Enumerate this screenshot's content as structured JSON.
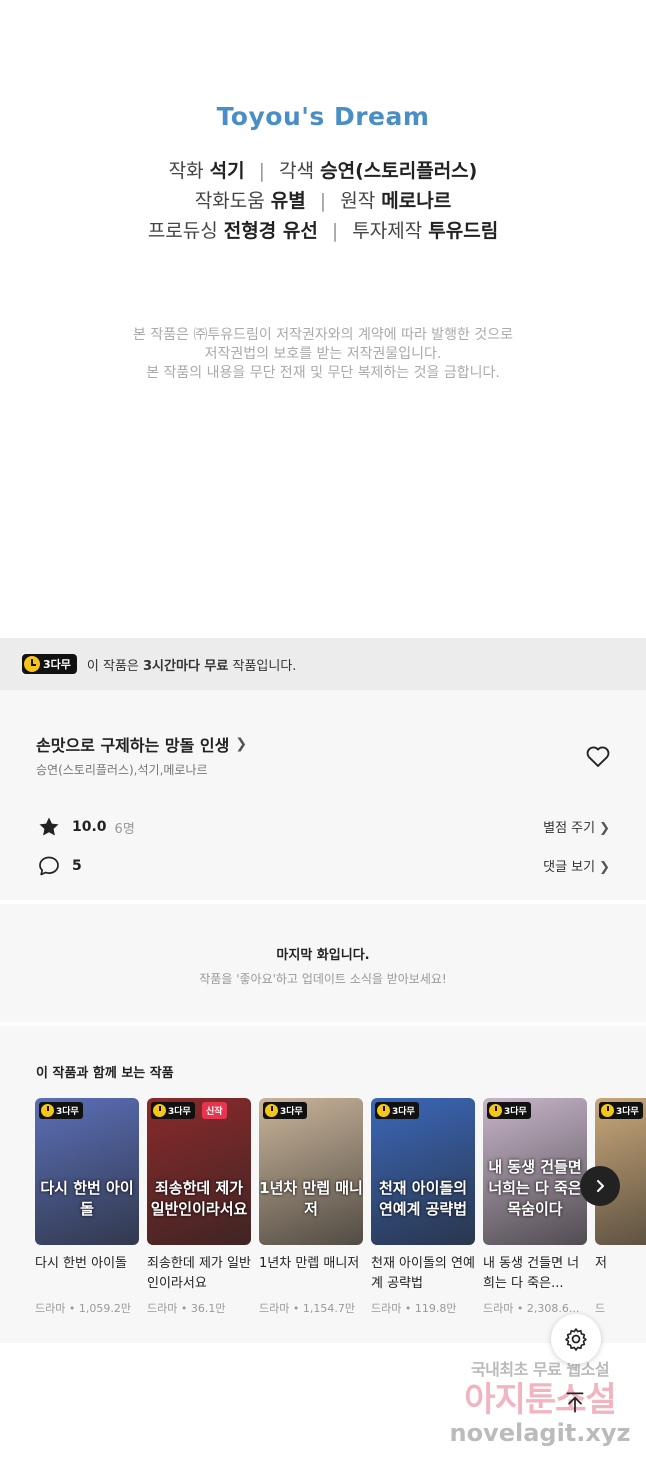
{
  "credits": {
    "logo": "Toyou's Dream",
    "line1": [
      {
        "label": "작화",
        "value": "석기"
      },
      {
        "label": "각색",
        "value": "승연(스토리플러스)"
      }
    ],
    "line2": [
      {
        "label": "작화도움",
        "value": "유별"
      },
      {
        "label": "원작",
        "value": "메로나르"
      }
    ],
    "line3": [
      {
        "label": "프로듀싱",
        "value": "전형경 유선"
      },
      {
        "label": "투자제작",
        "value": "투유드림"
      }
    ],
    "copyright": [
      "본 작품은 ㈜투유드림이 저작권자와의 계약에 따라 발행한 것으로",
      "저작권법의 보호를 받는 저작권물입니다.",
      "본 작품의 내용을 무단 전재 및 무단 복제하는 것을 금합니다."
    ]
  },
  "free_banner": {
    "badge": "3다무",
    "text_pre": "이 작품은 ",
    "text_bold": "3시간마다 무료",
    "text_post": " 작품입니다."
  },
  "work": {
    "title": "손맛으로 구제하는 망돌 인생",
    "authors": "승연(스토리플러스),석기,메로나르",
    "rating": "10.0",
    "rating_count": "6명",
    "rate_link": "별점 주기",
    "comments": "5",
    "comments_link": "댓글 보기"
  },
  "last_episode": {
    "title": "마지막 화입니다.",
    "subtitle": "작품을 '좋아요'하고 업데이트 소식을 받아보세요!"
  },
  "recommendations": {
    "heading": "이 작품과 함께 보는 작품",
    "badge": "3다무",
    "new_badge": "신작",
    "items": [
      {
        "title": "다시 한번 아이돌",
        "meta": "드라마 • 1,059.2만",
        "art": "다시 한번 아이돌",
        "color": "#5a6fb8",
        "is_new": false
      },
      {
        "title": "죄송한데 제가 일반인이라서요",
        "meta": "드라마 • 36.1만",
        "art": "죄송한데 제가 일반인이라서요",
        "color": "#8a2a2a",
        "is_new": true
      },
      {
        "title": "1년차 만렙 매니저",
        "meta": "드라마 • 1,154.7만",
        "art": "1년차 만렙 매니저",
        "color": "#c9b49a",
        "is_new": false
      },
      {
        "title": "천재 아이돌의 연예계 공략법",
        "meta": "드라마 • 119.8만",
        "art": "천재 아이돌의 연예계 공략법",
        "color": "#3b67b8",
        "is_new": false
      },
      {
        "title": "내 동생 건들면 너희는 다 죽은...",
        "meta": "드라마 • 2,308.6...",
        "art": "내 동생 건들면 너희는 다 죽은 목숨이다",
        "color": "#c7b5c9",
        "is_new": false
      },
      {
        "title": "저",
        "meta": "드",
        "art": "",
        "color": "#c9a87a",
        "is_new": false
      }
    ]
  },
  "watermark": {
    "line1": "국내최초 무료 웹소설",
    "line2": "아지툰소설",
    "line3": "novelagit.xyz"
  }
}
